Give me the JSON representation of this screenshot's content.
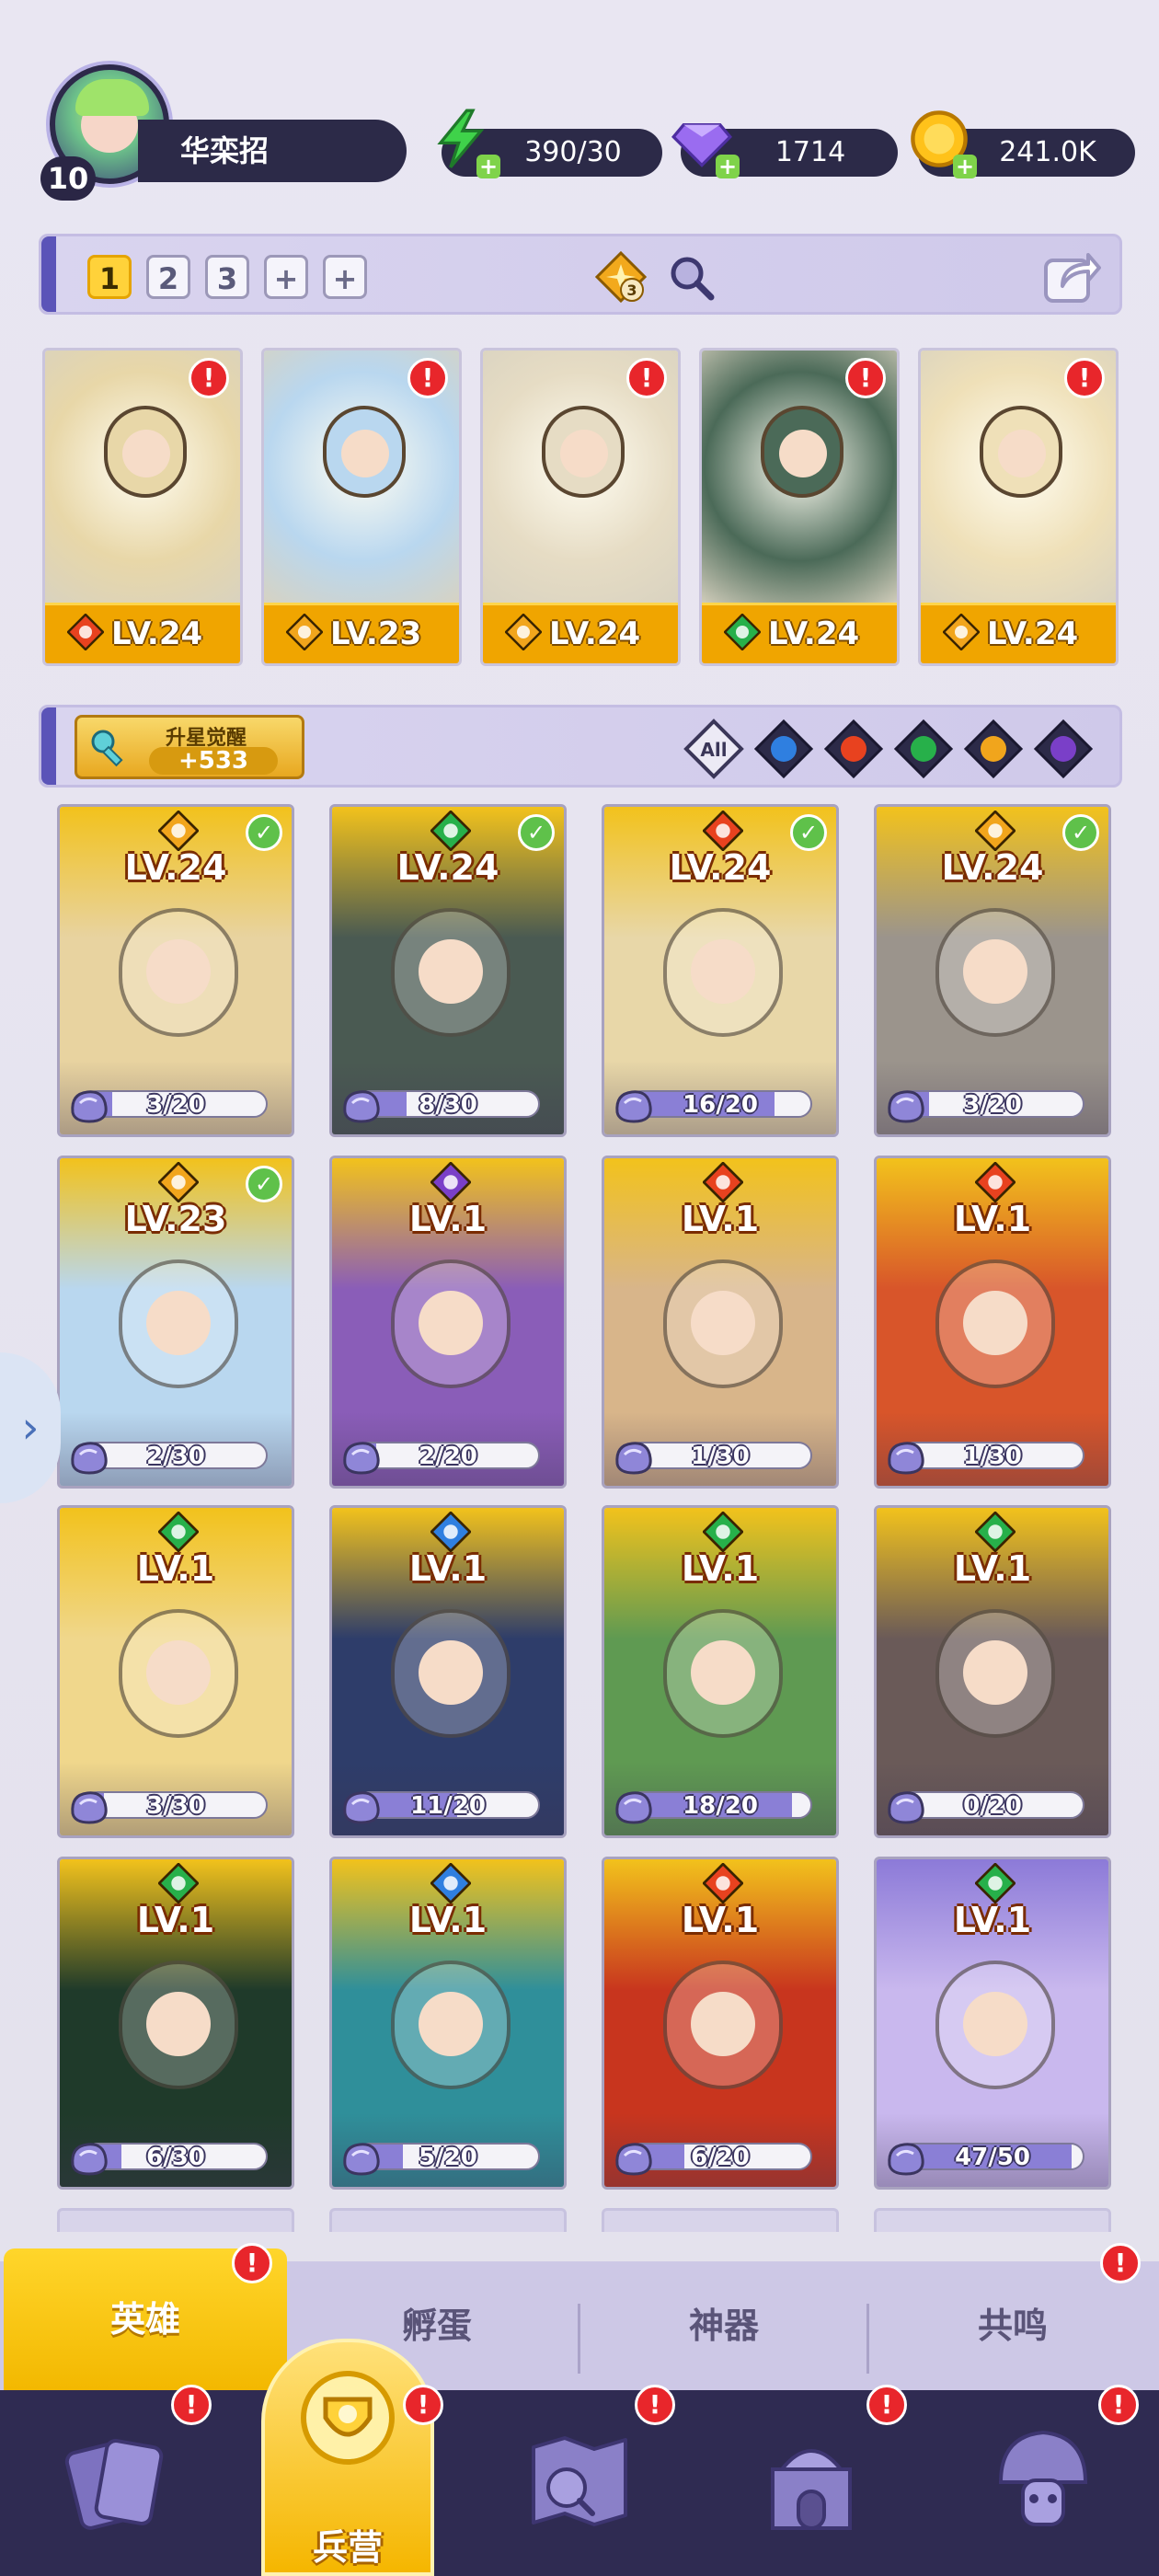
{
  "player": {
    "level": "10",
    "name": "华栾招"
  },
  "resources": {
    "energy": "390/30",
    "gems": "1714",
    "gold": "241.0K"
  },
  "team": {
    "slots": [
      "1",
      "2",
      "3",
      "+",
      "+"
    ],
    "active_slot": 0,
    "star_badge": "3"
  },
  "lineup": [
    {
      "element": "fire",
      "level": "LV.24",
      "alert": "!"
    },
    {
      "element": "light",
      "level": "LV.23",
      "alert": "!"
    },
    {
      "element": "light",
      "level": "LV.24",
      "alert": "!"
    },
    {
      "element": "wind",
      "level": "LV.24",
      "alert": "!"
    },
    {
      "element": "light",
      "level": "LV.24",
      "alert": "!"
    }
  ],
  "awaken": {
    "label": "升星觉醒",
    "count": "+533"
  },
  "filters": [
    "All",
    "water",
    "fire",
    "wind",
    "light",
    "dark"
  ],
  "heroes": [
    {
      "element": "light",
      "level": "LV.24",
      "shards": "3/20",
      "progress": 0.15,
      "checked": true,
      "tint": "#e8d3a0"
    },
    {
      "element": "wind",
      "level": "LV.24",
      "shards": "8/30",
      "progress": 0.27,
      "checked": true,
      "tint": "#4a5a52"
    },
    {
      "element": "fire",
      "level": "LV.24",
      "shards": "16/20",
      "progress": 0.8,
      "checked": true,
      "tint": "#e8d7a8"
    },
    {
      "element": "light",
      "level": "LV.24",
      "shards": "3/20",
      "progress": 0.15,
      "checked": true,
      "tint": "#9b948c"
    },
    {
      "element": "light",
      "level": "LV.23",
      "shards": "2/30",
      "progress": 0.07,
      "checked": true,
      "tint": "#b9d7ef"
    },
    {
      "element": "dark",
      "level": "LV.1",
      "shards": "2/20",
      "progress": 0.1,
      "checked": false,
      "tint": "#8a5db8"
    },
    {
      "element": "fire",
      "level": "LV.1",
      "shards": "1/30",
      "progress": 0.03,
      "checked": false,
      "tint": "#d8b58a"
    },
    {
      "element": "fire",
      "level": "LV.1",
      "shards": "1/30",
      "progress": 0.03,
      "checked": false,
      "tint": "#d8552a"
    },
    {
      "element": "wind",
      "level": "LV.1",
      "shards": "3/30",
      "progress": 0.1,
      "checked": false,
      "tint": "#f0d78c"
    },
    {
      "element": "water",
      "level": "LV.1",
      "shards": "11/20",
      "progress": 0.55,
      "checked": false,
      "tint": "#2e3d6a"
    },
    {
      "element": "wind",
      "level": "LV.1",
      "shards": "18/20",
      "progress": 0.9,
      "checked": false,
      "tint": "#5f9a52"
    },
    {
      "element": "wind",
      "level": "LV.1",
      "shards": "0/20",
      "progress": 0.0,
      "checked": false,
      "tint": "#6a5a58"
    },
    {
      "element": "wind",
      "level": "LV.1",
      "shards": "6/30",
      "progress": 0.2,
      "checked": false,
      "tint": "#1f3a2a"
    },
    {
      "element": "water",
      "level": "LV.1",
      "shards": "5/20",
      "progress": 0.25,
      "checked": false,
      "tint": "#2f8f9a"
    },
    {
      "element": "fire",
      "level": "LV.1",
      "shards": "6/20",
      "progress": 0.3,
      "checked": false,
      "tint": "#c8351e"
    },
    {
      "element": "wind",
      "level": "LV.1",
      "shards": "47/50",
      "progress": 0.94,
      "checked": false,
      "tint": "#c9b8ee"
    }
  ],
  "category_tabs": [
    {
      "label": "英雄",
      "active": true,
      "alert": "!"
    },
    {
      "label": "孵蛋",
      "active": false,
      "alert": ""
    },
    {
      "label": "神器",
      "active": false,
      "alert": ""
    },
    {
      "label": "共鸣",
      "active": false,
      "alert": "!"
    }
  ],
  "bottom_nav": [
    {
      "icon": "cards-icon",
      "label": "",
      "active": false,
      "alert": "!"
    },
    {
      "icon": "barracks-icon",
      "label": "兵营",
      "active": true,
      "alert": "!"
    },
    {
      "icon": "map-icon",
      "label": "",
      "active": false,
      "alert": "!"
    },
    {
      "icon": "castle-icon",
      "label": "",
      "active": false,
      "alert": "!"
    },
    {
      "icon": "mushroom-icon",
      "label": "",
      "active": false,
      "alert": "!"
    }
  ],
  "colors": {
    "fire": "#e8421f",
    "water": "#2f7fe0",
    "wind": "#27b04a",
    "light": "#f1a51c",
    "dark": "#7a3fc8",
    "gold_card": "#f2c21c",
    "purple_card": "#8c7ad8",
    "alert_red": "#e8262b"
  },
  "side_tab_glyph": "›"
}
